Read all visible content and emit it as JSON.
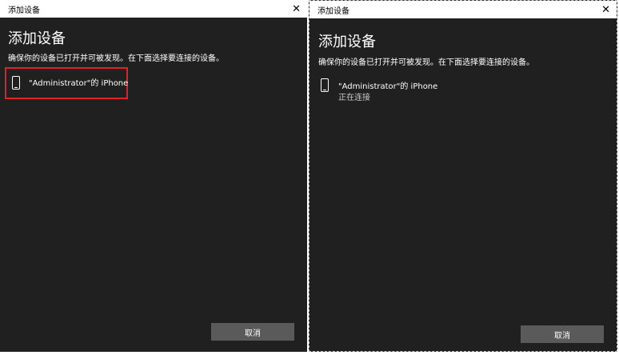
{
  "left_dialog": {
    "title": "添加设备",
    "heading": "添加设备",
    "subtitle": "确保你的设备已打开并可被发现。在下面选择要连接的设备。",
    "device": {
      "name": "\"Administrator\"的 iPhone",
      "icon": "phone-icon",
      "highlight_color": "#e0202a"
    },
    "cancel_label": "取消",
    "close_glyph": "✕"
  },
  "right_dialog": {
    "title": "添加设备",
    "heading": "添加设备",
    "subtitle": "确保你的设备已打开并可被发现。在下面选择要连接的设备。",
    "device": {
      "name": "\"Administrator\"的 iPhone",
      "status": "正在连接",
      "icon": "phone-icon"
    },
    "cancel_label": "取消",
    "close_glyph": "✕"
  }
}
